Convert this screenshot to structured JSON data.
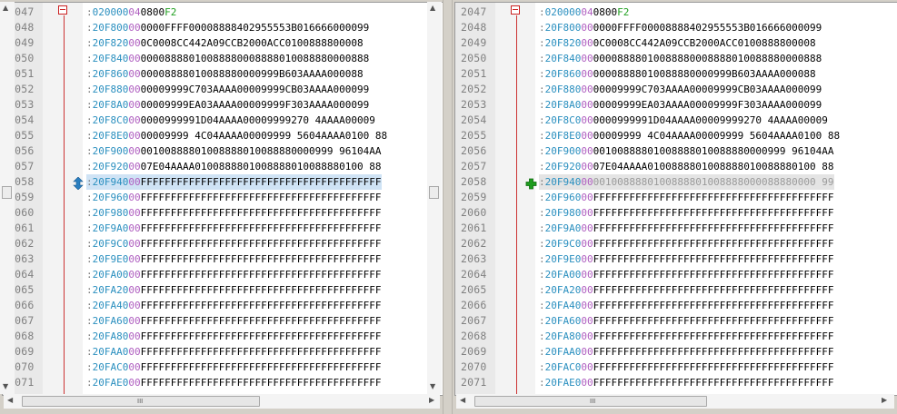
{
  "colors": {
    "length": "#2a8fbf",
    "address": "#2a8fbf",
    "record_type": "#b060c0",
    "data": "#000000",
    "checksum": "#20a020",
    "fold_marker": "#cc2222",
    "line_highlight_left": "#cfe3f5",
    "line_highlight_right": "#e4e4e4"
  },
  "left_pane": {
    "highlight_line": "2058",
    "marker_icon": "up-down-arrow-icon",
    "lines": [
      {
        "num": "2047",
        "len": "02",
        "addr": "0000",
        "type": "04",
        "data": "0800",
        "sum": "F2"
      },
      {
        "num": "2048",
        "len": "20",
        "addr": "F800",
        "type": "00",
        "data": "0000FFFF00008888402955553B016666000099",
        "sum": ""
      },
      {
        "num": "2049",
        "len": "20",
        "addr": "F820",
        "type": "00",
        "data": "0C0008CC442A09CCB2000ACC0100888800008",
        "sum": ""
      },
      {
        "num": "2050",
        "len": "20",
        "addr": "F840",
        "type": "00",
        "data": "00008888010088880008888010088880000888",
        "sum": ""
      },
      {
        "num": "2051",
        "len": "20",
        "addr": "F860",
        "type": "00",
        "data": "00008888010088880000999B603AAAA000088",
        "sum": ""
      },
      {
        "num": "2052",
        "len": "20",
        "addr": "F880",
        "type": "00",
        "data": "00009999C703AAAA00009999CB03AAAA000099",
        "sum": ""
      },
      {
        "num": "2053",
        "len": "20",
        "addr": "F8A0",
        "type": "00",
        "data": "00009999EA03AAAA00009999F303AAAA000099",
        "sum": ""
      },
      {
        "num": "2054",
        "len": "20",
        "addr": "F8C0",
        "type": "00",
        "data": "0000999991D04AAAA00009999270 4AAAA00009",
        "sum": ""
      },
      {
        "num": "2055",
        "len": "20",
        "addr": "F8E0",
        "type": "00",
        "data": "00009999 4C04AAAA00009999 5604AAAA0100 88",
        "sum": ""
      },
      {
        "num": "2056",
        "len": "20",
        "addr": "F900",
        "type": "00",
        "data": "00100888801008888010088880000999 96104AA",
        "sum": ""
      },
      {
        "num": "2057",
        "len": "20",
        "addr": "F920",
        "type": "00",
        "data": "07E04AAAA0100888801008888010088880100 88",
        "sum": ""
      },
      {
        "num": "2058",
        "len": "20",
        "addr": "F940",
        "type": "00",
        "data": "FFFFFFFFFFFFFFFFFFFFFFFFFFFFFFFFFFFFFFFF",
        "sum": ""
      },
      {
        "num": "2059",
        "len": "20",
        "addr": "F960",
        "type": "00",
        "data": "FFFFFFFFFFFFFFFFFFFFFFFFFFFFFFFFFFFFFFFF",
        "sum": ""
      },
      {
        "num": "2060",
        "len": "20",
        "addr": "F980",
        "type": "00",
        "data": "FFFFFFFFFFFFFFFFFFFFFFFFFFFFFFFFFFFFFFFF",
        "sum": ""
      },
      {
        "num": "2061",
        "len": "20",
        "addr": "F9A0",
        "type": "00",
        "data": "FFFFFFFFFFFFFFFFFFFFFFFFFFFFFFFFFFFFFFFF",
        "sum": ""
      },
      {
        "num": "2062",
        "len": "20",
        "addr": "F9C0",
        "type": "00",
        "data": "FFFFFFFFFFFFFFFFFFFFFFFFFFFFFFFFFFFFFFFF",
        "sum": ""
      },
      {
        "num": "2063",
        "len": "20",
        "addr": "F9E0",
        "type": "00",
        "data": "FFFFFFFFFFFFFFFFFFFFFFFFFFFFFFFFFFFFFFFF",
        "sum": ""
      },
      {
        "num": "2064",
        "len": "20",
        "addr": "FA00",
        "type": "00",
        "data": "FFFFFFFFFFFFFFFFFFFFFFFFFFFFFFFFFFFFFFFF",
        "sum": ""
      },
      {
        "num": "2065",
        "len": "20",
        "addr": "FA20",
        "type": "00",
        "data": "FFFFFFFFFFFFFFFFFFFFFFFFFFFFFFFFFFFFFFFF",
        "sum": ""
      },
      {
        "num": "2066",
        "len": "20",
        "addr": "FA40",
        "type": "00",
        "data": "FFFFFFFFFFFFFFFFFFFFFFFFFFFFFFFFFFFFFFFF",
        "sum": ""
      },
      {
        "num": "2067",
        "len": "20",
        "addr": "FA60",
        "type": "00",
        "data": "FFFFFFFFFFFFFFFFFFFFFFFFFFFFFFFFFFFFFFFF",
        "sum": ""
      },
      {
        "num": "2068",
        "len": "20",
        "addr": "FA80",
        "type": "00",
        "data": "FFFFFFFFFFFFFFFFFFFFFFFFFFFFFFFFFFFFFFFF",
        "sum": ""
      },
      {
        "num": "2069",
        "len": "20",
        "addr": "FAA0",
        "type": "00",
        "data": "FFFFFFFFFFFFFFFFFFFFFFFFFFFFFFFFFFFFFFFF",
        "sum": ""
      },
      {
        "num": "2070",
        "len": "20",
        "addr": "FAC0",
        "type": "00",
        "data": "FFFFFFFFFFFFFFFFFFFFFFFFFFFFFFFFFFFFFFFF",
        "sum": ""
      },
      {
        "num": "2071",
        "len": "20",
        "addr": "FAE0",
        "type": "00",
        "data": "FFFFFFFFFFFFFFFFFFFFFFFFFFFFFFFFFFFFFFFF",
        "sum": ""
      }
    ]
  },
  "right_pane": {
    "highlight_line": "2058",
    "marker_icon": "plus-icon",
    "lines": [
      {
        "num": "2047",
        "len": "02",
        "addr": "0000",
        "type": "04",
        "data": "0800",
        "sum": "F2"
      },
      {
        "num": "2048",
        "len": "20",
        "addr": "F800",
        "type": "00",
        "data": "0000FFFF00008888402955553B016666000099",
        "sum": ""
      },
      {
        "num": "2049",
        "len": "20",
        "addr": "F820",
        "type": "00",
        "data": "0C0008CC442A09CCB2000ACC0100888800008",
        "sum": ""
      },
      {
        "num": "2050",
        "len": "20",
        "addr": "F840",
        "type": "00",
        "data": "00008888010088880008888010088880000888",
        "sum": ""
      },
      {
        "num": "2051",
        "len": "20",
        "addr": "F860",
        "type": "00",
        "data": "00008888010088880000999B603AAAA000088",
        "sum": ""
      },
      {
        "num": "2052",
        "len": "20",
        "addr": "F880",
        "type": "00",
        "data": "00009999C703AAAA00009999CB03AAAA000099",
        "sum": ""
      },
      {
        "num": "2053",
        "len": "20",
        "addr": "F8A0",
        "type": "00",
        "data": "00009999EA03AAAA00009999F303AAAA000099",
        "sum": ""
      },
      {
        "num": "2054",
        "len": "20",
        "addr": "F8C0",
        "type": "00",
        "data": "0000999991D04AAAA00009999270 4AAAA00009",
        "sum": ""
      },
      {
        "num": "2055",
        "len": "20",
        "addr": "F8E0",
        "type": "00",
        "data": "00009999 4C04AAAA00009999 5604AAAA0100 88",
        "sum": ""
      },
      {
        "num": "2056",
        "len": "20",
        "addr": "F900",
        "type": "00",
        "data": "00100888801008888010088880000999 96104AA",
        "sum": ""
      },
      {
        "num": "2057",
        "len": "20",
        "addr": "F920",
        "type": "00",
        "data": "07E04AAAA0100888801008888010088880100 88",
        "sum": ""
      },
      {
        "num": "2058",
        "len": "20",
        "addr": "F940",
        "type": "00",
        "data": "0010088880100888801008888000088880000 99",
        "sum": ""
      },
      {
        "num": "2059",
        "len": "20",
        "addr": "F960",
        "type": "00",
        "data": "FFFFFFFFFFFFFFFFFFFFFFFFFFFFFFFFFFFFFFFF",
        "sum": ""
      },
      {
        "num": "2060",
        "len": "20",
        "addr": "F980",
        "type": "00",
        "data": "FFFFFFFFFFFFFFFFFFFFFFFFFFFFFFFFFFFFFFFF",
        "sum": ""
      },
      {
        "num": "2061",
        "len": "20",
        "addr": "F9A0",
        "type": "00",
        "data": "FFFFFFFFFFFFFFFFFFFFFFFFFFFFFFFFFFFFFFFF",
        "sum": ""
      },
      {
        "num": "2062",
        "len": "20",
        "addr": "F9C0",
        "type": "00",
        "data": "FFFFFFFFFFFFFFFFFFFFFFFFFFFFFFFFFFFFFFFF",
        "sum": ""
      },
      {
        "num": "2063",
        "len": "20",
        "addr": "F9E0",
        "type": "00",
        "data": "FFFFFFFFFFFFFFFFFFFFFFFFFFFFFFFFFFFFFFFF",
        "sum": ""
      },
      {
        "num": "2064",
        "len": "20",
        "addr": "FA00",
        "type": "00",
        "data": "FFFFFFFFFFFFFFFFFFFFFFFFFFFFFFFFFFFFFFFF",
        "sum": ""
      },
      {
        "num": "2065",
        "len": "20",
        "addr": "FA20",
        "type": "00",
        "data": "FFFFFFFFFFFFFFFFFFFFFFFFFFFFFFFFFFFFFFFF",
        "sum": ""
      },
      {
        "num": "2066",
        "len": "20",
        "addr": "FA40",
        "type": "00",
        "data": "FFFFFFFFFFFFFFFFFFFFFFFFFFFFFFFFFFFFFFFF",
        "sum": ""
      },
      {
        "num": "2067",
        "len": "20",
        "addr": "FA60",
        "type": "00",
        "data": "FFFFFFFFFFFFFFFFFFFFFFFFFFFFFFFFFFFFFFFF",
        "sum": ""
      },
      {
        "num": "2068",
        "len": "20",
        "addr": "FA80",
        "type": "00",
        "data": "FFFFFFFFFFFFFFFFFFFFFFFFFFFFFFFFFFFFFFFF",
        "sum": ""
      },
      {
        "num": "2069",
        "len": "20",
        "addr": "FAA0",
        "type": "00",
        "data": "FFFFFFFFFFFFFFFFFFFFFFFFFFFFFFFFFFFFFFFF",
        "sum": ""
      },
      {
        "num": "2070",
        "len": "20",
        "addr": "FAC0",
        "type": "00",
        "data": "FFFFFFFFFFFFFFFFFFFFFFFFFFFFFFFFFFFFFFFF",
        "sum": ""
      },
      {
        "num": "2071",
        "len": "20",
        "addr": "FAE0",
        "type": "00",
        "data": "FFFFFFFFFFFFFFFFFFFFFFFFFFFFFFFFFFFFFFFF",
        "sum": ""
      }
    ]
  },
  "scrollbars": {
    "grip_glyph": "III",
    "arrow_up": "▲",
    "arrow_down": "▼",
    "arrow_left": "◀",
    "arrow_right": "▶"
  }
}
